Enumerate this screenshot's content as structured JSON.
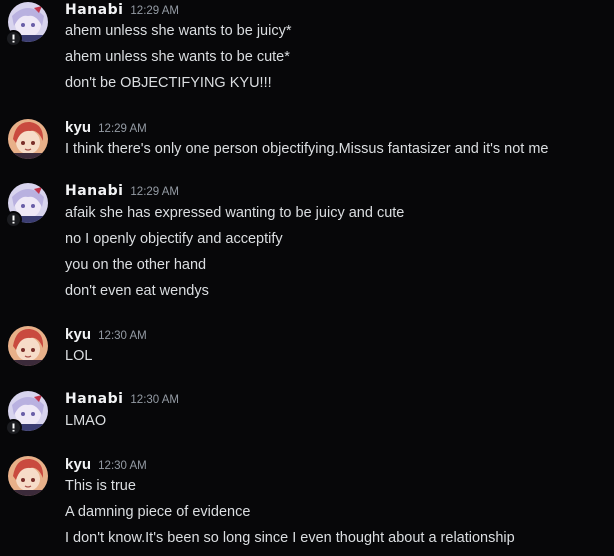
{
  "messages": [
    {
      "author": "Hanabi",
      "time": "12:29 AM",
      "lines": [
        "ahem unless she wants to be juicy*",
        "ahem unless she wants to be cute*",
        "don't be OBJECTIFYING KYU!!!"
      ]
    },
    {
      "author": "kyu",
      "time": "12:29 AM",
      "lines": [
        "I think there's only one person objectifying.Missus fantasizer and it's not me"
      ]
    },
    {
      "author": "Hanabi",
      "time": "12:29 AM",
      "lines": [
        "afaik she has expressed wanting to be juicy and cute",
        "no I openly objectify and acceptify",
        "you on the other hand",
        "don't even eat wendys"
      ]
    },
    {
      "author": "kyu",
      "time": "12:30 AM",
      "lines": [
        "LOL"
      ]
    },
    {
      "author": "Hanabi",
      "time": "12:30 AM",
      "lines": [
        "LMAO"
      ]
    },
    {
      "author": "kyu",
      "time": "12:30 AM",
      "lines": [
        "This is true",
        "A damning piece of evidence",
        "I don't know.It's been so long since I even thought about a relationship"
      ]
    }
  ],
  "colors": {
    "background": "#070709",
    "text": "#dbdee1",
    "username": "#f2f3f5",
    "timestamp": "#949ba4"
  },
  "icons": {
    "hanabi_avatar": "lavender-anime-avatar",
    "kyu_avatar": "red-haired-anime-avatar",
    "hanabi_badge": "exclamation-badge-icon"
  }
}
